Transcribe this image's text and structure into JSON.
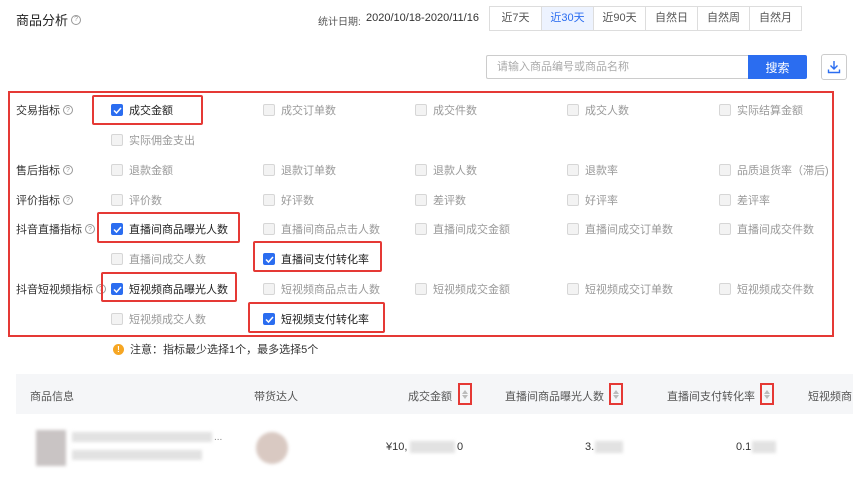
{
  "header": {
    "title": "商品分析",
    "date_label": "统计日期:",
    "date_range": "2020/10/18-2020/11/16",
    "tabs": [
      "近7天",
      "近30天",
      "近90天",
      "自然日",
      "自然周",
      "自然月"
    ],
    "active_tab": "近30天"
  },
  "search": {
    "placeholder": "请输入商品编号或商品名称",
    "button_label": "搜索"
  },
  "indicators": {
    "rows": [
      {
        "label": "交易指标",
        "items": [
          {
            "label": "成交金额",
            "checked": true
          },
          {
            "label": "成交订单数",
            "checked": false
          },
          {
            "label": "成交件数",
            "checked": false
          },
          {
            "label": "成交人数",
            "checked": false
          },
          {
            "label": "实际结算金额",
            "checked": false
          },
          {
            "label": "实际佣金支出",
            "checked": false
          }
        ]
      },
      {
        "label": "售后指标",
        "items": [
          {
            "label": "退款金额",
            "checked": false
          },
          {
            "label": "退款订单数",
            "checked": false
          },
          {
            "label": "退款人数",
            "checked": false
          },
          {
            "label": "退款率",
            "checked": false
          },
          {
            "label": "品质退货率（滞后)",
            "checked": false
          }
        ]
      },
      {
        "label": "评价指标",
        "items": [
          {
            "label": "评价数",
            "checked": false
          },
          {
            "label": "好评数",
            "checked": false
          },
          {
            "label": "差评数",
            "checked": false
          },
          {
            "label": "好评率",
            "checked": false
          },
          {
            "label": "差评率",
            "checked": false
          }
        ]
      },
      {
        "label": "抖音直播指标",
        "items": [
          {
            "label": "直播间商品曝光人数",
            "checked": true
          },
          {
            "label": "直播间商品点击人数",
            "checked": false
          },
          {
            "label": "直播间成交金额",
            "checked": false
          },
          {
            "label": "直播间成交订单数",
            "checked": false
          },
          {
            "label": "直播间成交件数",
            "checked": false
          },
          {
            "label": "直播间成交人数",
            "checked": false
          },
          {
            "label": "直播间支付转化率",
            "checked": true
          }
        ]
      },
      {
        "label": "抖音短视频指标",
        "items": [
          {
            "label": "短视频商品曝光人数",
            "checked": true
          },
          {
            "label": "短视频商品点击人数",
            "checked": false
          },
          {
            "label": "短视频成交金额",
            "checked": false
          },
          {
            "label": "短视频成交订单数",
            "checked": false
          },
          {
            "label": "短视频成交件数",
            "checked": false
          },
          {
            "label": "短视频成交人数",
            "checked": false
          },
          {
            "label": "短视频支付转化率",
            "checked": true
          }
        ]
      }
    ],
    "notice": "注意：指标最少选择1个，最多选择5个"
  },
  "table": {
    "columns": [
      "商品信息",
      "带货达人",
      "成交金额",
      "直播间商品曝光人数",
      "直播间支付转化率",
      "短视频商"
    ],
    "row": {
      "product_suffix": "...",
      "amount_prefix": "¥10,",
      "amount_suffix": "0",
      "exposure_prefix": "3.",
      "conversion_prefix": "0.1"
    }
  },
  "colors": {
    "accent": "#2b6df0",
    "highlight": "#e53935",
    "warning": "#f6a623"
  }
}
